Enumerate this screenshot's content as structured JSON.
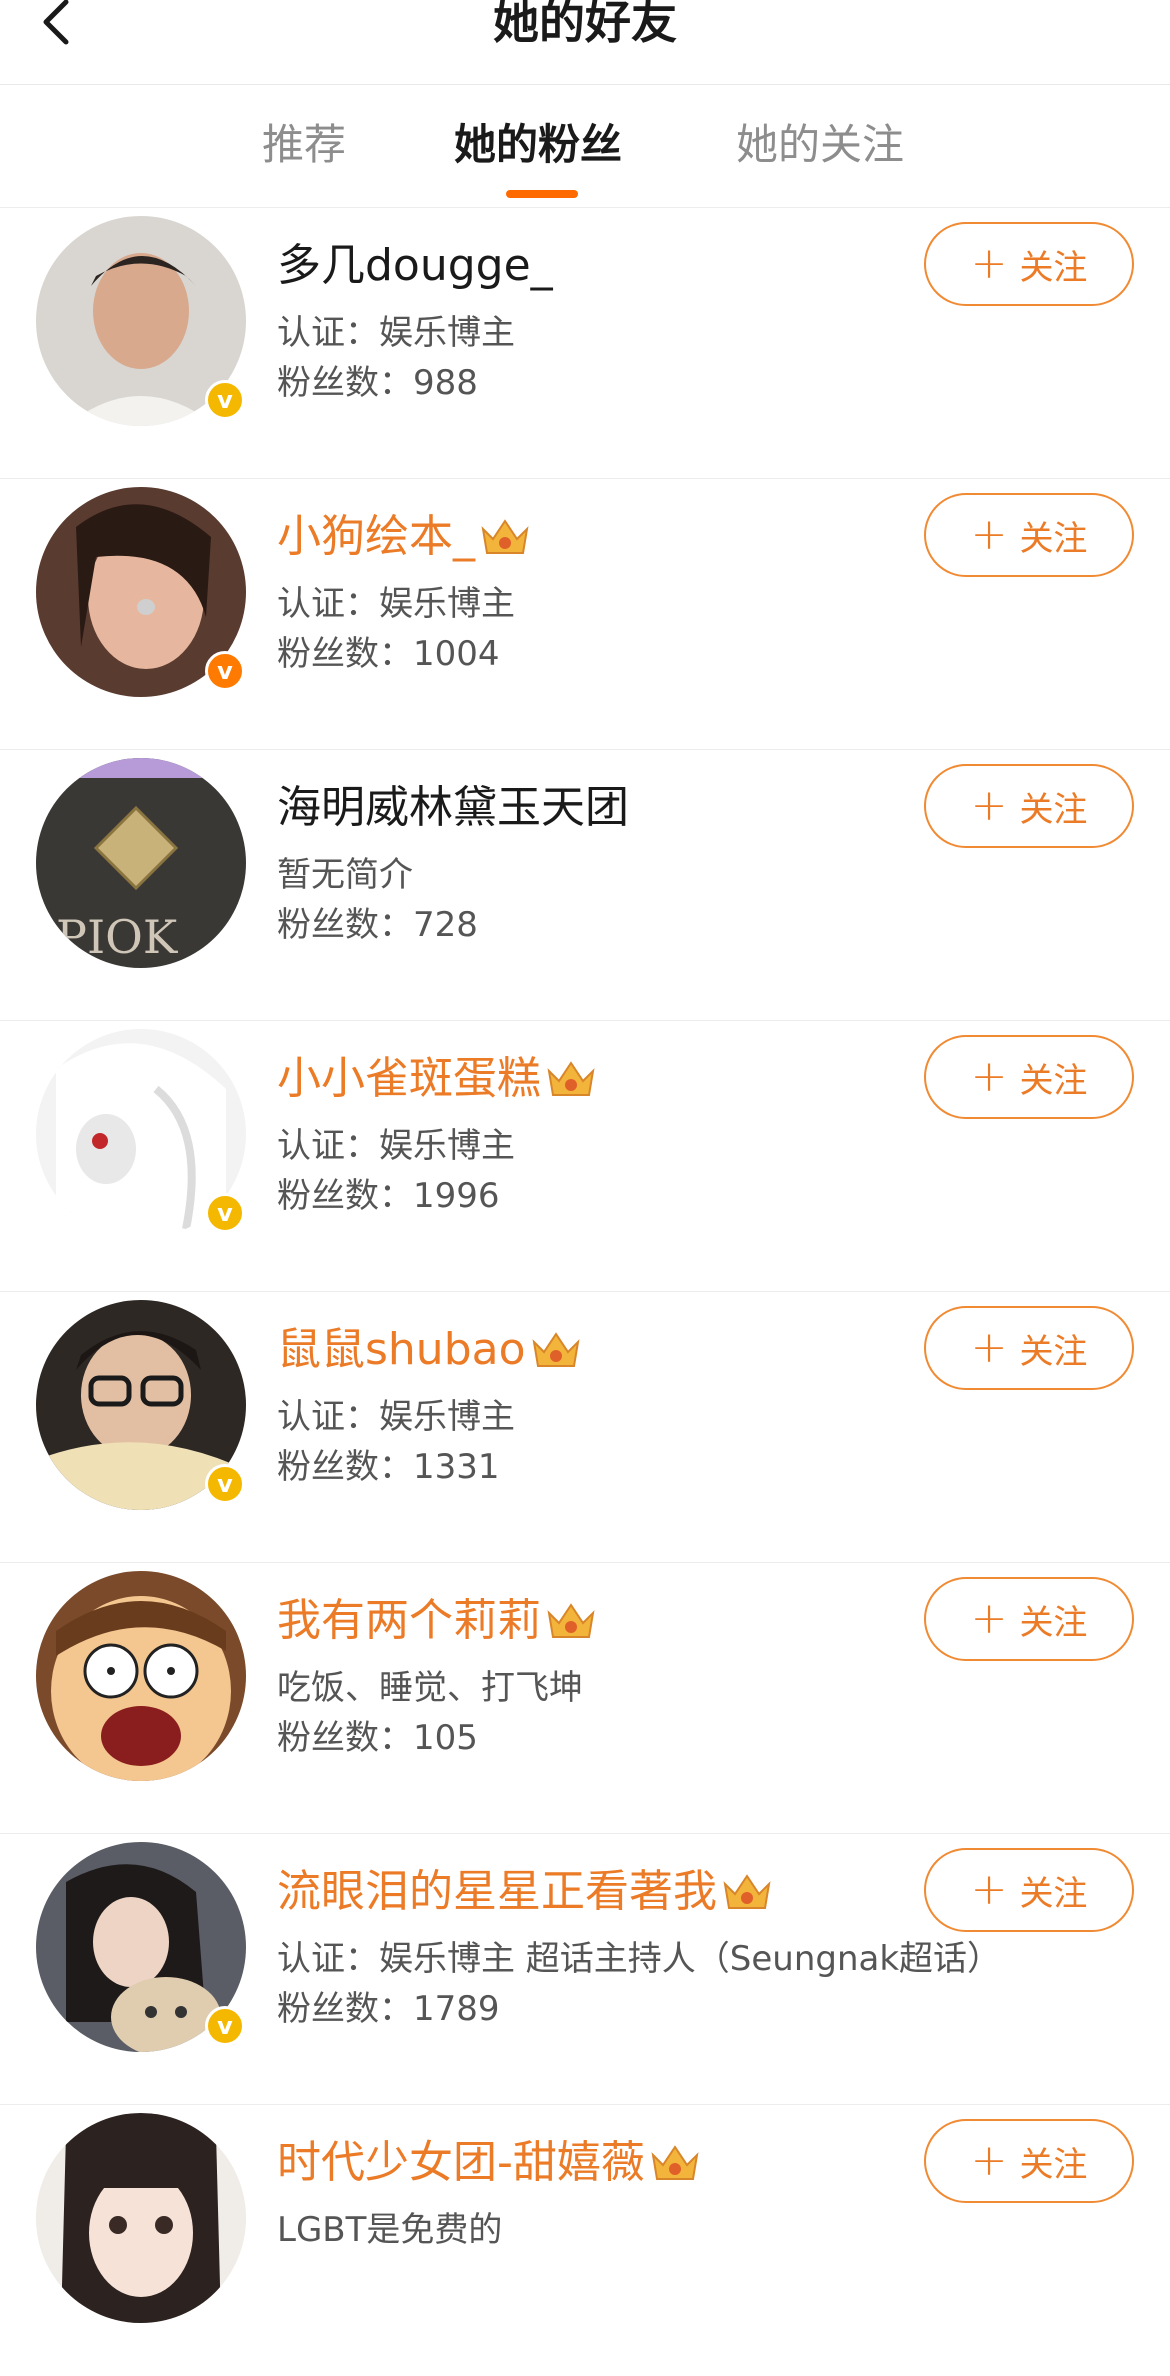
{
  "header": {
    "title": "她的好友",
    "back_icon": "chevron-left-icon"
  },
  "tabs": [
    {
      "label": "推荐",
      "active": false
    },
    {
      "label": "她的粉丝",
      "active": true
    },
    {
      "label": "她的关注",
      "active": false
    }
  ],
  "colors": {
    "accent": "#ff6a00",
    "vip_name": "#eb7b26",
    "badge_yellow": "#f5b800",
    "badge_orange": "#ff7a00"
  },
  "follow_label": "关注",
  "users": [
    {
      "name": "多几dougge_",
      "vip": false,
      "desc": "认证：娱乐博主",
      "fans": "粉丝数：988",
      "badge": "yellow",
      "badge_text": "v"
    },
    {
      "name": "小狗绘本_",
      "vip": true,
      "desc": "认证：娱乐博主",
      "fans": "粉丝数：1004",
      "badge": "orange",
      "badge_text": "v"
    },
    {
      "name": "海明威林黛玉天团",
      "vip": false,
      "desc": "暂无简介",
      "fans": "粉丝数：728",
      "badge": null
    },
    {
      "name": "小小雀斑蛋糕",
      "vip": true,
      "desc": "认证：娱乐博主",
      "fans": "粉丝数：1996",
      "badge": "yellow",
      "badge_text": "v"
    },
    {
      "name": "鼠鼠shubao",
      "vip": true,
      "desc": "认证：娱乐博主",
      "fans": "粉丝数：1331",
      "badge": "yellow",
      "badge_text": "v"
    },
    {
      "name": "我有两个莉莉",
      "vip": true,
      "desc": "吃饭、睡觉、打飞坤",
      "fans": "粉丝数：105",
      "badge": null
    },
    {
      "name": "流眼泪的星星正看著我",
      "vip": true,
      "desc": "认证：娱乐博主 超话主持人（Seungnak超话）",
      "fans": "粉丝数：1789",
      "badge": "yellow",
      "badge_text": "v"
    },
    {
      "name": "时代少女团-甜嬉薇",
      "vip": true,
      "desc": "LGBT是免费的",
      "fans": "",
      "badge": null
    }
  ]
}
